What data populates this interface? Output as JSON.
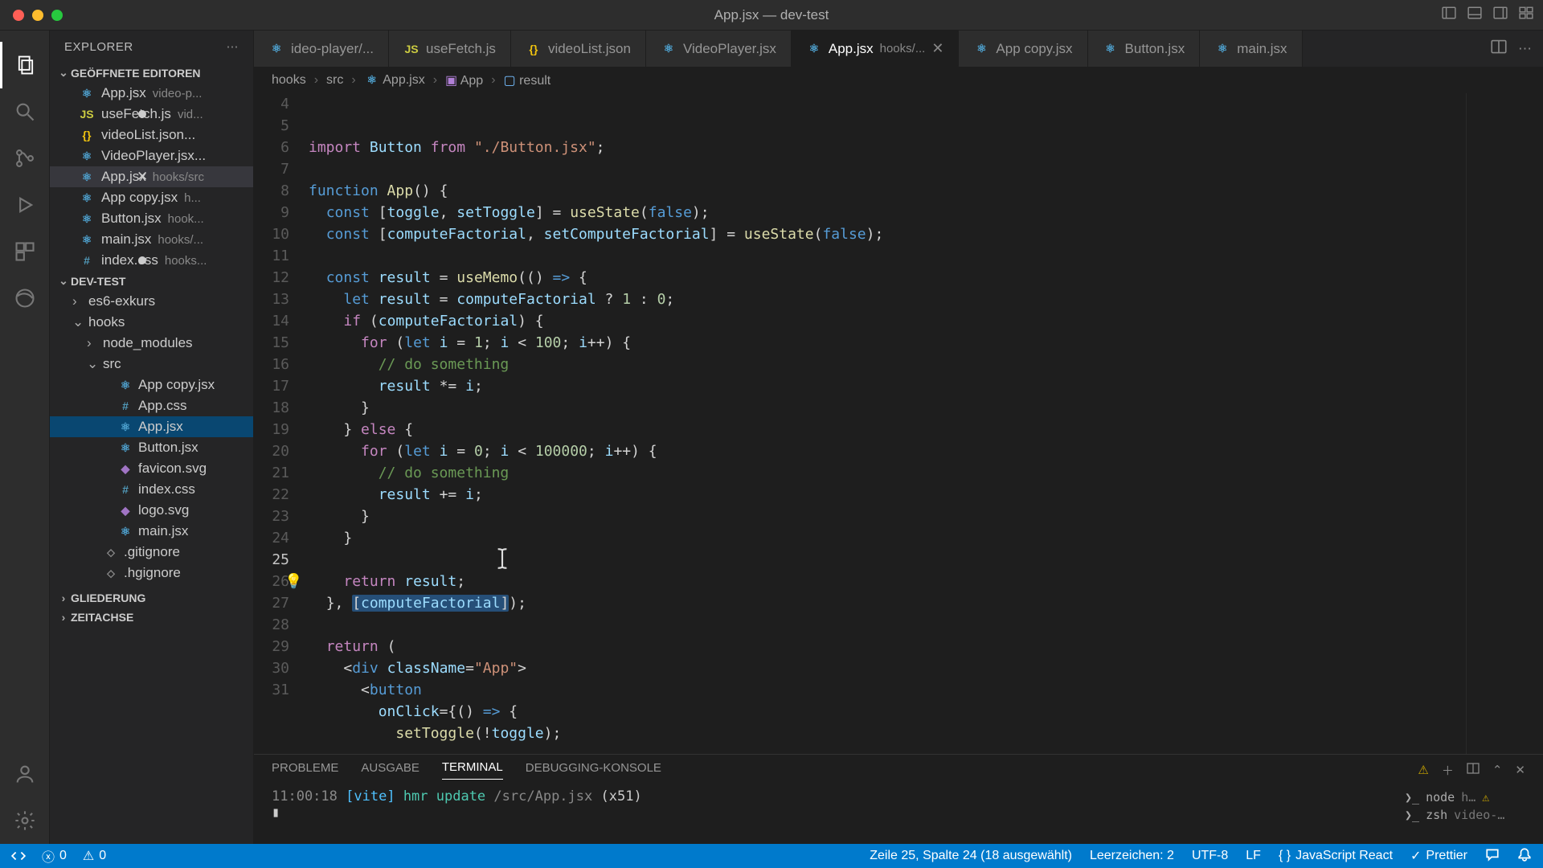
{
  "titlebar": {
    "title": "App.jsx — dev-test"
  },
  "sidebar": {
    "header": "EXPLORER",
    "sections": {
      "openEditors": "GEÖFFNETE EDITOREN",
      "project": "DEV-TEST",
      "outline": "GLIEDERUNG",
      "timeline": "ZEITACHSE"
    },
    "openEditors": [
      {
        "name": "App.jsx",
        "tag": "video-p..."
      },
      {
        "name": "useFetch.js",
        "tag": "vid..."
      },
      {
        "name": "videoList.json...",
        "tag": ""
      },
      {
        "name": "VideoPlayer.jsx...",
        "tag": ""
      },
      {
        "name": "App.jsx",
        "tag": "hooks/src"
      },
      {
        "name": "App copy.jsx",
        "tag": "h..."
      },
      {
        "name": "Button.jsx",
        "tag": "hook..."
      },
      {
        "name": "main.jsx",
        "tag": "hooks/..."
      },
      {
        "name": "index.css",
        "tag": "hooks..."
      }
    ],
    "tree": {
      "folders": {
        "es6": "es6-exkurs",
        "hooks": "hooks",
        "node_modules": "node_modules",
        "src": "src"
      },
      "srcFiles": [
        "App copy.jsx",
        "App.css",
        "App.jsx",
        "Button.jsx",
        "favicon.svg",
        "index.css",
        "logo.svg",
        "main.jsx"
      ],
      "rootFiles": [
        ".gitignore",
        ".hgignore"
      ]
    }
  },
  "tabs": [
    {
      "label": "ideo-player/..."
    },
    {
      "label": "useFetch.js"
    },
    {
      "label": "videoList.json"
    },
    {
      "label": "VideoPlayer.jsx"
    },
    {
      "label": "App.jsx",
      "sub": "hooks/...",
      "active": true,
      "close": true
    },
    {
      "label": "App copy.jsx"
    },
    {
      "label": "Button.jsx"
    },
    {
      "label": "main.jsx"
    }
  ],
  "breadcrumb": [
    "hooks",
    "src",
    "App.jsx",
    "App",
    "result"
  ],
  "code": {
    "startLine": 4,
    "lines": [
      {
        "n": 4,
        "html": "<span class='tok-kw'>import</span> <span class='tok-var'>Button</span> <span class='tok-kw'>from</span> <span class='tok-str'>\"./Button.jsx\"</span><span class='tok-plain'>;</span>"
      },
      {
        "n": 5,
        "html": ""
      },
      {
        "n": 6,
        "html": "<span class='tok-kw2'>function</span> <span class='tok-fn'>App</span><span class='tok-plain'>() {</span>"
      },
      {
        "n": 7,
        "html": "  <span class='tok-kw2'>const</span> <span class='tok-plain'>[</span><span class='tok-var'>toggle</span><span class='tok-plain'>, </span><span class='tok-var'>setToggle</span><span class='tok-plain'>] = </span><span class='tok-fn'>useState</span><span class='tok-plain'>(</span><span class='tok-kw2'>false</span><span class='tok-plain'>);</span>"
      },
      {
        "n": 8,
        "html": "  <span class='tok-kw2'>const</span> <span class='tok-plain'>[</span><span class='tok-var'>computeFactorial</span><span class='tok-plain'>, </span><span class='tok-var'>setComputeFactorial</span><span class='tok-plain'>] = </span><span class='tok-fn'>useState</span><span class='tok-plain'>(</span><span class='tok-kw2'>false</span><span class='tok-plain'>);</span>"
      },
      {
        "n": 9,
        "html": ""
      },
      {
        "n": 10,
        "html": "  <span class='tok-kw2'>const</span> <span class='tok-var'>result</span> <span class='tok-plain'>= </span><span class='tok-fn'>useMemo</span><span class='tok-plain'>(</span><span class='tok-plain'>() </span><span class='tok-kw2'>=&gt;</span><span class='tok-plain'> {</span>"
      },
      {
        "n": 11,
        "html": "    <span class='tok-kw2'>let</span> <span class='tok-var'>result</span> <span class='tok-plain'>= </span><span class='tok-var'>computeFactorial</span> <span class='tok-plain'>? </span><span class='tok-num'>1</span><span class='tok-plain'> : </span><span class='tok-num'>0</span><span class='tok-plain'>;</span>"
      },
      {
        "n": 12,
        "html": "    <span class='tok-kw'>if</span> <span class='tok-plain'>(</span><span class='tok-var'>computeFactorial</span><span class='tok-plain'>) {</span>"
      },
      {
        "n": 13,
        "html": "      <span class='tok-kw'>for</span> <span class='tok-plain'>(</span><span class='tok-kw2'>let</span> <span class='tok-var'>i</span> <span class='tok-plain'>= </span><span class='tok-num'>1</span><span class='tok-plain'>; </span><span class='tok-var'>i</span> <span class='tok-plain'>&lt; </span><span class='tok-num'>100</span><span class='tok-plain'>; </span><span class='tok-var'>i</span><span class='tok-plain'>++) {</span>"
      },
      {
        "n": 14,
        "html": "        <span class='tok-cmt'>// do something</span>"
      },
      {
        "n": 15,
        "html": "        <span class='tok-var'>result</span> <span class='tok-plain'>*= </span><span class='tok-var'>i</span><span class='tok-plain'>;</span>"
      },
      {
        "n": 16,
        "html": "      <span class='tok-plain'>}</span>"
      },
      {
        "n": 17,
        "html": "    <span class='tok-plain'>} </span><span class='tok-kw'>else</span><span class='tok-plain'> {</span>"
      },
      {
        "n": 18,
        "html": "      <span class='tok-kw'>for</span> <span class='tok-plain'>(</span><span class='tok-kw2'>let</span> <span class='tok-var'>i</span> <span class='tok-plain'>= </span><span class='tok-num'>0</span><span class='tok-plain'>; </span><span class='tok-var'>i</span> <span class='tok-plain'>&lt; </span><span class='tok-num'>100000</span><span class='tok-plain'>; </span><span class='tok-var'>i</span><span class='tok-plain'>++) {</span>"
      },
      {
        "n": 19,
        "html": "        <span class='tok-cmt'>// do something</span>"
      },
      {
        "n": 20,
        "html": "        <span class='tok-var'>result</span> <span class='tok-plain'>+= </span><span class='tok-var'>i</span><span class='tok-plain'>;</span>"
      },
      {
        "n": 21,
        "html": "      <span class='tok-plain'>}</span>"
      },
      {
        "n": 22,
        "html": "    <span class='tok-plain'>}</span>"
      },
      {
        "n": 23,
        "html": ""
      },
      {
        "n": 24,
        "html": "    <span class='bulb'>💡</span><span class='tok-kw'>return</span> <span class='tok-var'>result</span><span class='tok-plain'>;</span>"
      },
      {
        "n": 25,
        "html": "  <span class='tok-plain'>}, </span><span class='sel'><span class='tok-plain'>[</span><span class='tok-var'>computeFactorial</span><span class='tok-plain'>]</span></span><span class='tok-plain'>);</span>"
      },
      {
        "n": 26,
        "html": ""
      },
      {
        "n": 27,
        "html": "  <span class='tok-kw'>return</span> <span class='tok-plain'>(</span>"
      },
      {
        "n": 28,
        "html": "    <span class='tok-plain'>&lt;</span><span class='tok-tag'>div</span> <span class='tok-attr'>className</span><span class='tok-plain'>=</span><span class='tok-str'>\"App\"</span><span class='tok-plain'>&gt;</span>"
      },
      {
        "n": 29,
        "html": "      <span class='tok-plain'>&lt;</span><span class='tok-tag'>button</span>"
      },
      {
        "n": 30,
        "html": "        <span class='tok-attr'>onClick</span><span class='tok-plain'>={() </span><span class='tok-kw2'>=&gt;</span><span class='tok-plain'> {</span>"
      },
      {
        "n": 31,
        "html": "          <span class='tok-fn'>setToggle</span><span class='tok-plain'>(!</span><span class='tok-var'>toggle</span><span class='tok-plain'>);</span>"
      }
    ],
    "currentLine": 25
  },
  "panel": {
    "tabs": [
      "PROBLEME",
      "AUSGABE",
      "TERMINAL",
      "DEBUGGING-KONSOLE"
    ],
    "activeTab": "TERMINAL",
    "terminal": {
      "time": "11:00:18",
      "tag": "[vite]",
      "msg": "hmr update",
      "path": "/src/App.jsx",
      "count": "(x51)"
    },
    "procs": [
      {
        "name": "node",
        "tag": "h…"
      },
      {
        "name": "zsh",
        "tag": "video-…"
      }
    ]
  },
  "statusbar": {
    "errors": "0",
    "warnings": "0",
    "position": "Zeile 25, Spalte 24 (18 ausgewählt)",
    "indent": "Leerzeichen: 2",
    "encoding": "UTF-8",
    "eol": "LF",
    "lang": "JavaScript React",
    "prettier": "Prettier"
  }
}
